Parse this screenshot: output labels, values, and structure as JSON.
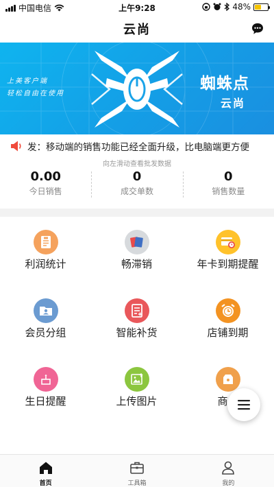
{
  "status_bar": {
    "carrier": "中国电信",
    "time": "上午9:28",
    "battery": "48%",
    "battery_level": 0.48
  },
  "header": {
    "title": "云尚"
  },
  "banner": {
    "slogan_line1": "上美客户端",
    "slogan_line2": "轻松自由在使用",
    "brand_name": "蜘蛛点",
    "brand_sub": "云尚",
    "logo_icon": "spider-logo-icon"
  },
  "notice": {
    "icon": "speaker-icon",
    "text": "发：移动端的销售功能已经全面升级，比电脑端更方便"
  },
  "swipe_hint": "向左滑动查看批发数据",
  "stats": [
    {
      "value": "0.00",
      "label": "今日销售"
    },
    {
      "value": "0",
      "label": "成交单数"
    },
    {
      "value": "0",
      "label": "销售数量"
    }
  ],
  "menu": [
    {
      "label": "利润统计",
      "icon": "profit-document-icon",
      "color": "#f5a25d"
    },
    {
      "label": "畅滞销",
      "icon": "sales-cards-icon",
      "color": "#d7dadd"
    },
    {
      "label": "年卡到期提醒",
      "icon": "card-alarm-icon",
      "color": "#ffc22b"
    },
    {
      "label": "会员分组",
      "icon": "member-folder-icon",
      "color": "#6b9bd1"
    },
    {
      "label": "智能补货",
      "icon": "restock-document-icon",
      "color": "#e9585b"
    },
    {
      "label": "店铺到期",
      "icon": "alarm-clock-icon",
      "color": "#f39322"
    },
    {
      "label": "生日提醒",
      "icon": "birthday-cake-icon",
      "color": "#f06595"
    },
    {
      "label": "上传图片",
      "icon": "upload-image-icon",
      "color": "#8cc63f"
    },
    {
      "label": "商品",
      "icon": "product-tag-icon",
      "color": "#f0a04b"
    }
  ],
  "fab": {
    "icon": "menu-icon"
  },
  "tabs": [
    {
      "label": "首页",
      "icon": "home-icon",
      "active": true
    },
    {
      "label": "工具箱",
      "icon": "toolbox-icon",
      "active": false
    },
    {
      "label": "我的",
      "icon": "user-icon",
      "active": false
    }
  ]
}
